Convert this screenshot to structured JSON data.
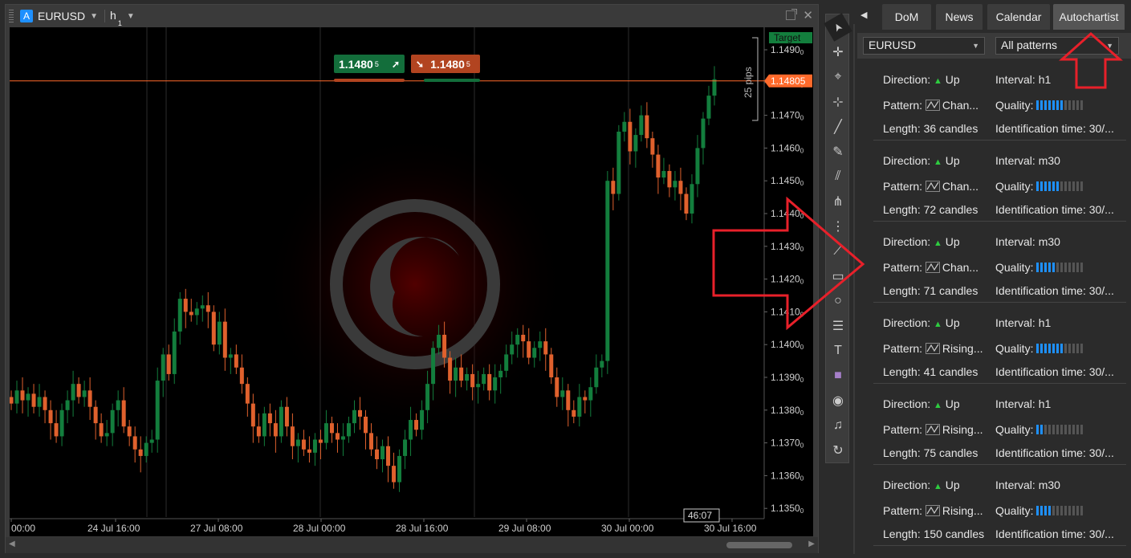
{
  "chart": {
    "symbol": "EURUSD",
    "symbol_badge": "A",
    "timeframe": "h",
    "timeframe_sub": "1",
    "buy_price": "1.1480",
    "buy_price_sub": "5",
    "sell_price": "1.1480",
    "sell_price_sub": "5",
    "target_label": "Target",
    "current_price_label": "1.14805",
    "pips_label": "25 pips",
    "countdown": "46:07",
    "price_axis": [
      "1.1490",
      "1.1480",
      "1.1470",
      "1.1460",
      "1.1450",
      "1.1440",
      "1.1430",
      "1.1420",
      "1.1410",
      "1.1400",
      "1.1390",
      "1.1380",
      "1.1370",
      "1.1360",
      "1.1350"
    ],
    "price_axis_sub": "0",
    "time_axis": [
      "00:00",
      "24 Jul 16:00",
      "27 Jul 08:00",
      "28 Jul 00:00",
      "28 Jul 16:00",
      "29 Jul 08:00",
      "30 Jul 00:00",
      "30 Jul 16:00"
    ],
    "colors": {
      "bull": "#137e3d",
      "bear": "#e0612d",
      "price_line": "#ff6a2b",
      "background": "#000000"
    }
  },
  "tools": [
    "pointer-icon",
    "crosshair-icon",
    "zoom-icon",
    "cross-tool-icon",
    "trend-line-icon",
    "pencil-icon",
    "fib-fan-icon",
    "pitchfork-icon",
    "fib-retracement-icon",
    "gann-fan-icon",
    "rectangle-icon",
    "circle-icon",
    "fib-levels-icon",
    "text-icon",
    "color-swatch-icon",
    "camera-icon",
    "alert-bell-icon",
    "replay-icon"
  ],
  "panel": {
    "tabs": [
      "DoM",
      "News",
      "Calendar",
      "Autochartist"
    ],
    "active_tab": "Autochartist",
    "symbol_select": "EURUSD",
    "pattern_select": "All patterns",
    "labels": {
      "direction": "Direction:",
      "interval": "Interval:",
      "pattern": "Pattern:",
      "quality": "Quality:",
      "length": "Length:",
      "identification": "Identification time: 30/..."
    },
    "patterns": [
      {
        "direction": "Up",
        "interval": "h1",
        "pattern": "Chan...",
        "quality": 0.6,
        "length": "36 candles"
      },
      {
        "direction": "Up",
        "interval": "m30",
        "pattern": "Chan...",
        "quality": 0.5,
        "length": "72 candles"
      },
      {
        "direction": "Up",
        "interval": "m30",
        "pattern": "Chan...",
        "quality": 0.4,
        "length": "71 candles"
      },
      {
        "direction": "Up",
        "interval": "h1",
        "pattern": "Rising...",
        "quality": 0.6,
        "length": "41 candles"
      },
      {
        "direction": "Up",
        "interval": "h1",
        "pattern": "Rising...",
        "quality": 0.2,
        "length": "75 candles"
      },
      {
        "direction": "Up",
        "interval": "m30",
        "pattern": "Rising...",
        "quality": 0.3,
        "length": "150 candles"
      }
    ]
  }
}
